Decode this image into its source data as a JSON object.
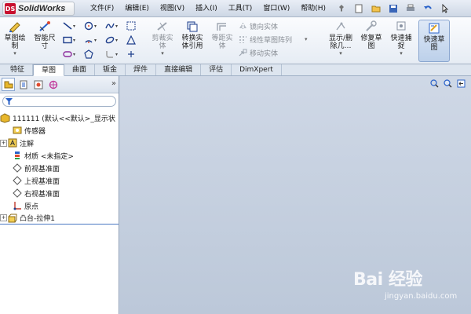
{
  "app": {
    "logo": "SolidWorks"
  },
  "menu": [
    "文件(F)",
    "编辑(E)",
    "视图(V)",
    "插入(I)",
    "工具(T)",
    "窗口(W)",
    "帮助(H)"
  ],
  "ribbon": {
    "sketch": "草图绘\n制",
    "smart_dim": "智能尺\n寸",
    "trim": "剪裁实\n体",
    "convert": "转换实\n体引用",
    "offset": "等距实\n体",
    "mirror": "镜向实体",
    "linear_pattern": "线性草图阵列",
    "move": "移动实体",
    "show_delete": "显示/删\n除几…",
    "repair": "修复草\n图",
    "quick_capture": "快速捕\n捉",
    "quick_sketch": "快速草\n图"
  },
  "tabs": [
    "特征",
    "草图",
    "曲面",
    "钣金",
    "焊件",
    "直接编辑",
    "评估",
    "DimXpert"
  ],
  "active_tab": "草图",
  "tree": {
    "root": "111111  (默认<<默认>_显示状",
    "items": [
      "传感器",
      "注解",
      "材质 <未指定>",
      "前视基准面",
      "上视基准面",
      "右视基准面",
      "原点",
      "凸台-拉伸1"
    ]
  },
  "watermark": {
    "brand": "Bai 经验",
    "url": "jingyan.baidu.com"
  },
  "colors": {
    "accent": "#2a62c9",
    "logo_red": "#c8102e",
    "graphics_bg": "#c4cfde"
  }
}
